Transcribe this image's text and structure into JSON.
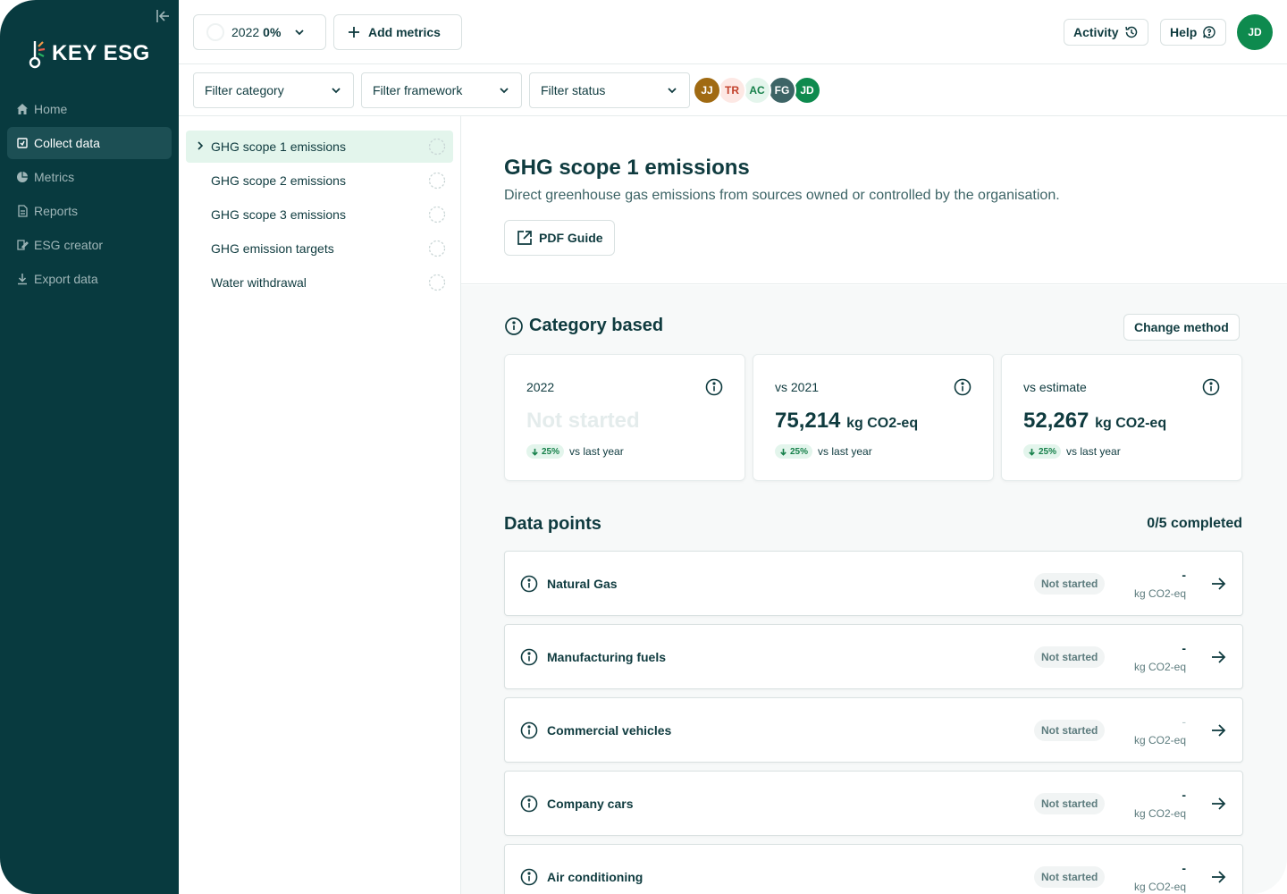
{
  "sidebar": {
    "brand": "KEY ESG",
    "items": [
      {
        "label": "Home",
        "icon": "home-icon"
      },
      {
        "label": "Collect data",
        "icon": "collect-icon"
      },
      {
        "label": "Metrics",
        "icon": "pie-chart-icon"
      },
      {
        "label": "Reports",
        "icon": "document-icon"
      },
      {
        "label": "ESG creator",
        "icon": "edit-document-icon"
      },
      {
        "label": "Export data",
        "icon": "download-icon"
      }
    ]
  },
  "topbar": {
    "year": "2022",
    "progress": "0%",
    "add_metrics": "Add metrics",
    "activity": "Activity",
    "help": "Help",
    "user_initials": "JD"
  },
  "filters": {
    "category": "Filter category",
    "framework": "Filter framework",
    "status": "Filter status"
  },
  "collaborators": [
    {
      "initials": "JJ",
      "bg": "#a06a12",
      "fg": "#ffffff"
    },
    {
      "initials": "TR",
      "bg": "#fde8e4",
      "fg": "#c2412b"
    },
    {
      "initials": "AC",
      "bg": "#e4f5ec",
      "fg": "#16804a"
    },
    {
      "initials": "FG",
      "bg": "#3d6466",
      "fg": "#ffffff"
    },
    {
      "initials": "JD",
      "bg": "#0e8a4e",
      "fg": "#ffffff"
    }
  ],
  "metrics": [
    {
      "label": "GHG scope 1 emissions"
    },
    {
      "label": "GHG scope 2 emissions"
    },
    {
      "label": "GHG scope 3 emissions"
    },
    {
      "label": "GHG emission targets"
    },
    {
      "label": "Water withdrawal"
    }
  ],
  "detail": {
    "title": "GHG scope 1 emissions",
    "description": "Direct greenhouse gas emissions from sources owned or controlled by the organisation.",
    "pdf_guide": "PDF Guide",
    "section": "Category based",
    "change_method": "Change method",
    "cards": [
      {
        "label": "2022",
        "value": "Not started",
        "unit": "",
        "change": "25%",
        "change_text": "vs last year"
      },
      {
        "label": "vs 2021",
        "value": "75,214",
        "unit": "kg CO2-eq",
        "change": "25%",
        "change_text": "vs last year"
      },
      {
        "label": "vs estimate",
        "value": "52,267",
        "unit": "kg CO2-eq",
        "change": "25%",
        "change_text": "vs last year"
      }
    ],
    "data_points_title": "Data points",
    "completed": "0/5 completed",
    "data_points": [
      {
        "name": "Natural Gas",
        "status": "Not started",
        "value": "-",
        "unit": "kg CO2-eq"
      },
      {
        "name": "Manufacturing fuels",
        "status": "Not started",
        "value": "-",
        "unit": "kg CO2-eq"
      },
      {
        "name": "Commercial vehicles",
        "status": "Not started",
        "value": "-",
        "unit": "kg CO2-eq"
      },
      {
        "name": "Company cars",
        "status": "Not started",
        "value": "-",
        "unit": "kg CO2-eq"
      },
      {
        "name": "Air conditioning",
        "status": "Not started",
        "value": "-",
        "unit": "kg CO2-eq"
      }
    ]
  },
  "colors": {
    "sidebar_bg": "#083a3f",
    "accent_green": "#0e8a4e",
    "active_row": "#e3f5ec",
    "text": "#0f3b3f"
  }
}
